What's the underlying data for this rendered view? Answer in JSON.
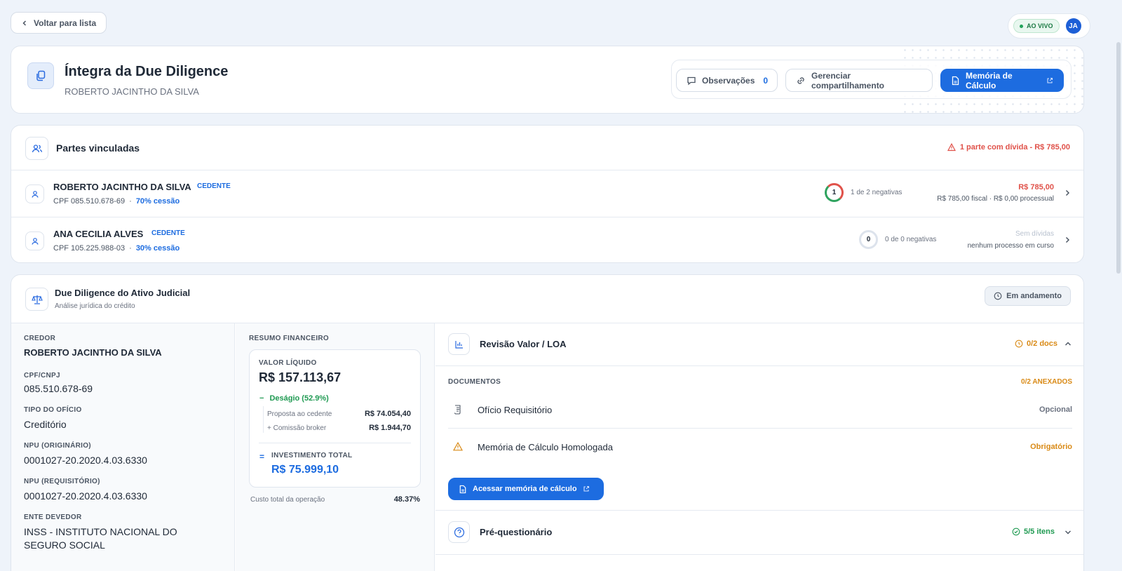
{
  "topbar": {
    "back_label": "Voltar para lista",
    "live_label": "AO VIVO",
    "avatar_initials": "JA"
  },
  "header": {
    "title": "Íntegra da Due Diligence",
    "subtitle": "ROBERTO JACINTHO DA SILVA",
    "observacoes_label": "Observações",
    "observacoes_count": "0",
    "share_label": "Gerenciar compartilhamento",
    "memoria_label": "Memória de Cálculo"
  },
  "partes": {
    "title": "Partes vinculadas",
    "alert": "1 parte com dívida - R$ 785,00",
    "items": [
      {
        "name": "ROBERTO JACINTHO DA SILVA",
        "role": "CEDENTE",
        "cpf": "CPF 085.510.678-69",
        "share": "70% cessão",
        "negativas_count": "1",
        "negativas": "1 de 2 negativas",
        "amount": "R$ 785,00",
        "detail": "R$ 785,00 fiscal · R$ 0,00 processual"
      },
      {
        "name": "ANA CECILIA ALVES",
        "role": "CEDENTE",
        "cpf": "CPF 105.225.988-03",
        "share": "30% cessão",
        "negativas_count": "0",
        "negativas": "0 de 0 negativas",
        "amount": "Sem dívidas",
        "detail": "nenhum processo em curso"
      }
    ]
  },
  "dd": {
    "title": "Due Diligence do Ativo Judicial",
    "subtitle": "Análise jurídica do crédito",
    "status": "Em andamento",
    "fields": [
      {
        "label": "CREDOR",
        "value": "ROBERTO JACINTHO DA SILVA"
      },
      {
        "label": "CPF/CNPJ",
        "value": "085.510.678-69"
      },
      {
        "label": "TIPO DO OFÍCIO",
        "value": "Creditório"
      },
      {
        "label": "NPU (ORIGINÁRIO)",
        "value": "0001027-20.2020.4.03.6330"
      },
      {
        "label": "NPU (REQUISITÓRIO)",
        "value": "0001027-20.2020.4.03.6330"
      },
      {
        "label": "ENTE DEVEDOR",
        "value": "INSS - INSTITUTO NACIONAL DO SEGURO SOCIAL"
      }
    ],
    "resumo": {
      "title": "RESUMO FINANCEIRO",
      "liquido_label": "VALOR LÍQUIDO",
      "liquido_value": "R$ 157.113,67",
      "desagio_label": "Deságio (52.9%)",
      "proposta_label": "Proposta ao cedente",
      "proposta_value": "R$ 74.054,40",
      "comissao_label": "+ Comissão broker",
      "comissao_value": "R$ 1.944,70",
      "invest_label": "INVESTIMENTO TOTAL",
      "invest_value": "R$ 75.999,10",
      "custo_label": "Custo total da operação",
      "custo_value": "48.37%"
    },
    "revisao": {
      "title": "Revisão Valor / LOA",
      "docs_status": "0/2 docs",
      "docs_label": "DOCUMENTOS",
      "anexados": "0/2 ANEXADOS",
      "docs": [
        {
          "name": "Ofício Requisitório",
          "tag": "Opcional"
        },
        {
          "name": "Memória de Cálculo Homologada",
          "tag": "Obrigatório"
        }
      ],
      "access_label": "Acessar memória de cálculo"
    },
    "pre": {
      "title": "Pré-questionário",
      "status": "5/5 itens"
    }
  }
}
